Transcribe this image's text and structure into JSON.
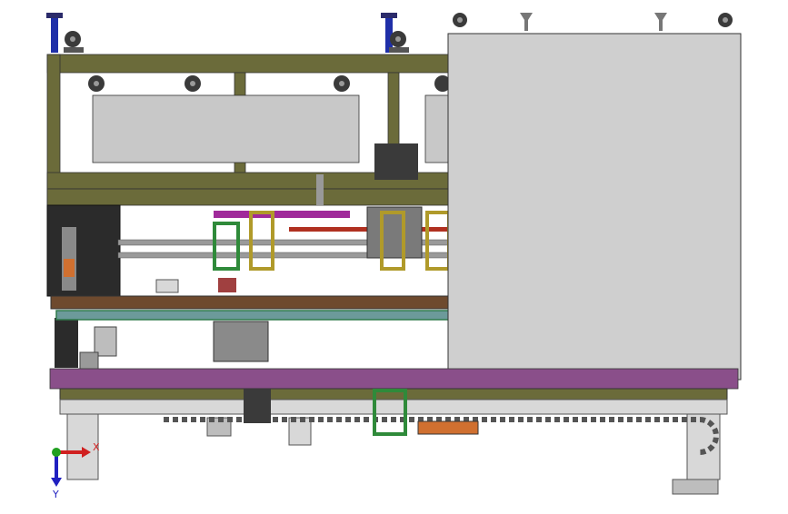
{
  "view": {
    "background": "#ffffff",
    "colors": {
      "frame_olive": "#6b6b3a",
      "frame_olive_dark": "#4e4e26",
      "panel_gray": "#c8c8c8",
      "box_gray": "#cfcfcf",
      "base_purple": "#8a4f8a",
      "rail_green": "#2f7a4a",
      "rail_teal": "#6c9a9a",
      "plate_brown": "#6e4a2e",
      "dark_column": "#2b2b2b",
      "blue_post": "#1f2fa8",
      "chain_gray": "#9a9a9a",
      "orange_motor": "#d07030",
      "red_rod": "#b03020",
      "magenta_bar": "#a02a9a",
      "yellow_bracket": "#b09a2a",
      "green_bracket": "#2f8a3a"
    }
  },
  "triad": {
    "x_label": "X",
    "y_label": "Y",
    "x_color": "#d02020",
    "y_color": "#2020c0",
    "origin_color": "#20a020"
  }
}
